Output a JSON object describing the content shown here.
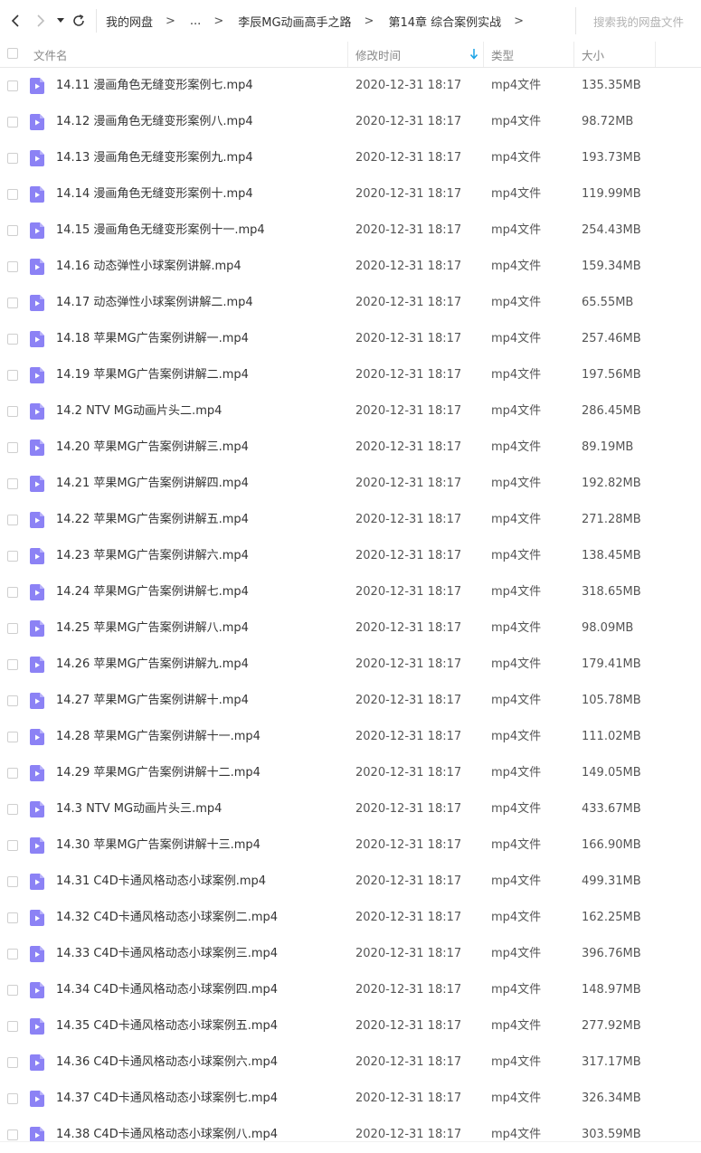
{
  "toolbar": {
    "breadcrumb": [
      "我的网盘",
      "...",
      "李辰MG动画高手之路",
      "第14章 综合案例实战"
    ],
    "search_placeholder": "搜索我的网盘文件"
  },
  "columns": {
    "name": "文件名",
    "modified": "修改时间",
    "type": "类型",
    "size": "大小"
  },
  "accent": "#1aa3e6",
  "file_icon_color": "#8c82f5",
  "files": [
    {
      "name": "14.11 漫画角色无缝变形案例七.mp4",
      "modified": "2020-12-31 18:17",
      "type": "mp4文件",
      "size": "135.35MB"
    },
    {
      "name": "14.12 漫画角色无缝变形案例八.mp4",
      "modified": "2020-12-31 18:17",
      "type": "mp4文件",
      "size": "98.72MB"
    },
    {
      "name": "14.13 漫画角色无缝变形案例九.mp4",
      "modified": "2020-12-31 18:17",
      "type": "mp4文件",
      "size": "193.73MB"
    },
    {
      "name": "14.14 漫画角色无缝变形案例十.mp4",
      "modified": "2020-12-31 18:17",
      "type": "mp4文件",
      "size": "119.99MB"
    },
    {
      "name": "14.15 漫画角色无缝变形案例十一.mp4",
      "modified": "2020-12-31 18:17",
      "type": "mp4文件",
      "size": "254.43MB"
    },
    {
      "name": "14.16 动态弹性小球案例讲解.mp4",
      "modified": "2020-12-31 18:17",
      "type": "mp4文件",
      "size": "159.34MB"
    },
    {
      "name": "14.17 动态弹性小球案例讲解二.mp4",
      "modified": "2020-12-31 18:17",
      "type": "mp4文件",
      "size": "65.55MB"
    },
    {
      "name": "14.18 苹果MG广告案例讲解一.mp4",
      "modified": "2020-12-31 18:17",
      "type": "mp4文件",
      "size": "257.46MB"
    },
    {
      "name": "14.19 苹果MG广告案例讲解二.mp4",
      "modified": "2020-12-31 18:17",
      "type": "mp4文件",
      "size": "197.56MB"
    },
    {
      "name": "14.2 NTV MG动画片头二.mp4",
      "modified": "2020-12-31 18:17",
      "type": "mp4文件",
      "size": "286.45MB"
    },
    {
      "name": "14.20 苹果MG广告案例讲解三.mp4",
      "modified": "2020-12-31 18:17",
      "type": "mp4文件",
      "size": "89.19MB"
    },
    {
      "name": "14.21 苹果MG广告案例讲解四.mp4",
      "modified": "2020-12-31 18:17",
      "type": "mp4文件",
      "size": "192.82MB"
    },
    {
      "name": "14.22 苹果MG广告案例讲解五.mp4",
      "modified": "2020-12-31 18:17",
      "type": "mp4文件",
      "size": "271.28MB"
    },
    {
      "name": "14.23 苹果MG广告案例讲解六.mp4",
      "modified": "2020-12-31 18:17",
      "type": "mp4文件",
      "size": "138.45MB"
    },
    {
      "name": "14.24 苹果MG广告案例讲解七.mp4",
      "modified": "2020-12-31 18:17",
      "type": "mp4文件",
      "size": "318.65MB"
    },
    {
      "name": "14.25 苹果MG广告案例讲解八.mp4",
      "modified": "2020-12-31 18:17",
      "type": "mp4文件",
      "size": "98.09MB"
    },
    {
      "name": "14.26 苹果MG广告案例讲解九.mp4",
      "modified": "2020-12-31 18:17",
      "type": "mp4文件",
      "size": "179.41MB"
    },
    {
      "name": "14.27 苹果MG广告案例讲解十.mp4",
      "modified": "2020-12-31 18:17",
      "type": "mp4文件",
      "size": "105.78MB"
    },
    {
      "name": "14.28 苹果MG广告案例讲解十一.mp4",
      "modified": "2020-12-31 18:17",
      "type": "mp4文件",
      "size": "111.02MB"
    },
    {
      "name": "14.29 苹果MG广告案例讲解十二.mp4",
      "modified": "2020-12-31 18:17",
      "type": "mp4文件",
      "size": "149.05MB"
    },
    {
      "name": "14.3 NTV MG动画片头三.mp4",
      "modified": "2020-12-31 18:17",
      "type": "mp4文件",
      "size": "433.67MB"
    },
    {
      "name": "14.30 苹果MG广告案例讲解十三.mp4",
      "modified": "2020-12-31 18:17",
      "type": "mp4文件",
      "size": "166.90MB"
    },
    {
      "name": "14.31 C4D卡通风格动态小球案例.mp4",
      "modified": "2020-12-31 18:17",
      "type": "mp4文件",
      "size": "499.31MB"
    },
    {
      "name": "14.32 C4D卡通风格动态小球案例二.mp4",
      "modified": "2020-12-31 18:17",
      "type": "mp4文件",
      "size": "162.25MB"
    },
    {
      "name": "14.33 C4D卡通风格动态小球案例三.mp4",
      "modified": "2020-12-31 18:17",
      "type": "mp4文件",
      "size": "396.76MB"
    },
    {
      "name": "14.34 C4D卡通风格动态小球案例四.mp4",
      "modified": "2020-12-31 18:17",
      "type": "mp4文件",
      "size": "148.97MB"
    },
    {
      "name": "14.35 C4D卡通风格动态小球案例五.mp4",
      "modified": "2020-12-31 18:17",
      "type": "mp4文件",
      "size": "277.92MB"
    },
    {
      "name": "14.36 C4D卡通风格动态小球案例六.mp4",
      "modified": "2020-12-31 18:17",
      "type": "mp4文件",
      "size": "317.17MB"
    },
    {
      "name": "14.37 C4D卡通风格动态小球案例七.mp4",
      "modified": "2020-12-31 18:17",
      "type": "mp4文件",
      "size": "326.34MB"
    },
    {
      "name": "14.38 C4D卡通风格动态小球案例八.mp4",
      "modified": "2020-12-31 18:17",
      "type": "mp4文件",
      "size": "303.59MB"
    }
  ]
}
